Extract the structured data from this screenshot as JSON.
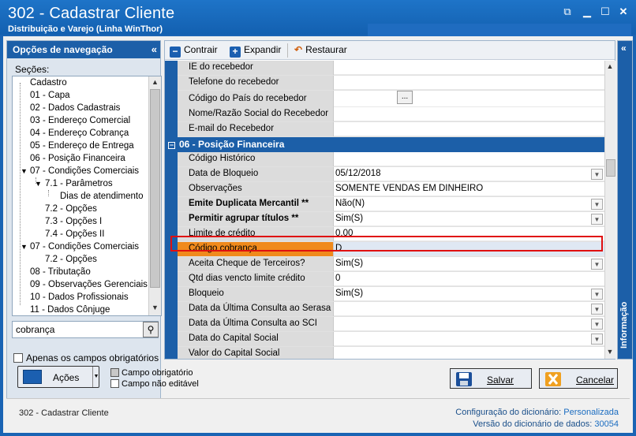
{
  "window": {
    "title": "302 - Cadastrar Cliente",
    "subtitle": "Distribuição e Varejo (Linha WinThor)",
    "controls": [
      "restore-icon",
      "minimize-icon",
      "maximize-icon",
      "close-icon"
    ]
  },
  "nav": {
    "header": "Opções de navegação",
    "sections_label": "Seções:",
    "items": [
      {
        "label": "Cadastro"
      },
      {
        "label": "01 - Capa"
      },
      {
        "label": "02 - Dados Cadastrais"
      },
      {
        "label": "03 - Endereço Comercial"
      },
      {
        "label": "04 - Endereço Cobrança"
      },
      {
        "label": "05 - Endereço de Entrega"
      },
      {
        "label": "06 - Posição Financeira"
      },
      {
        "label": "07 - Condições Comerciais"
      },
      {
        "label": "7.1 - Parâmetros"
      },
      {
        "label": "Dias de atendimento"
      },
      {
        "label": "7.2 - Opções"
      },
      {
        "label": "7.3 - Opções I"
      },
      {
        "label": "7.4 - Opções II"
      },
      {
        "label": "07 - Condições Comerciais"
      },
      {
        "label": "7.2 - Opções"
      },
      {
        "label": "08 - Tributação"
      },
      {
        "label": "09 - Observações Gerenciais"
      },
      {
        "label": "10 - Dados Profissionais"
      },
      {
        "label": "11 - Dados Cônjuge"
      }
    ],
    "search_value": "cobrança",
    "required_only_label": "Apenas os campos obrigatórios"
  },
  "toolbar": {
    "contrair": "Contrair",
    "expandir": "Expandir",
    "restaurar": "Restaurar"
  },
  "grid": {
    "rows_top": [
      {
        "label": "IE do recebedor",
        "value": ""
      },
      {
        "label": "Telefone do recebedor",
        "value": ""
      },
      {
        "label": "Código do País do recebedor",
        "value": "",
        "button": "..."
      },
      {
        "label": "Nome/Razão Social do Recebedor",
        "value": ""
      },
      {
        "label": "E-mail do Recebedor",
        "value": ""
      }
    ],
    "section_title": "06 - Posição Financeira",
    "section_toggle": "−",
    "rows": [
      {
        "label": "Código Histórico",
        "value": ""
      },
      {
        "label": "Data de Bloqueio",
        "value": "05/12/2018"
      },
      {
        "label": "Observações",
        "value": "SOMENTE VENDAS EM DINHEIRO"
      },
      {
        "label": "Emite Duplicata Mercantil **",
        "value": "Não(N)"
      },
      {
        "label": "Permitir agrupar títulos **",
        "value": "Sim(S)"
      },
      {
        "label": "Limite de crédito",
        "value": "0,00"
      },
      {
        "label": "Código cobrança",
        "value": "D"
      },
      {
        "label": "Aceita Cheque de Terceiros?",
        "value": "Sim(S)"
      },
      {
        "label": "Qtd dias vencto limite crédito",
        "value": "0"
      },
      {
        "label": "Bloqueio",
        "value": "Sim(S)"
      },
      {
        "label": "Data da Última Consulta ao Serasa",
        "value": ""
      },
      {
        "label": "Data da Última Consulta ao SCI",
        "value": ""
      },
      {
        "label": "Data do Capital Social",
        "value": ""
      },
      {
        "label": "Valor do Capital Social",
        "value": ""
      }
    ]
  },
  "info_panel": {
    "label": "Informação"
  },
  "footer": {
    "acoes": "Ações",
    "legend_required": "Campo obrigatório",
    "legend_noneditable": "Campo não editável",
    "salvar": "Salvar",
    "cancelar": "Cancelar",
    "status": "302 - Cadastrar Cliente",
    "config_label": "Configuração do dicionário:",
    "config_value": "Personalizada",
    "version_label": "Versão do dicionário de dados:",
    "version_value": "30054"
  },
  "colors": {
    "title_bar": "#1360b0",
    "nav_header": "#1c5fa8",
    "highlight_row": "#f08a1c",
    "highlight_border": "#e01010"
  }
}
